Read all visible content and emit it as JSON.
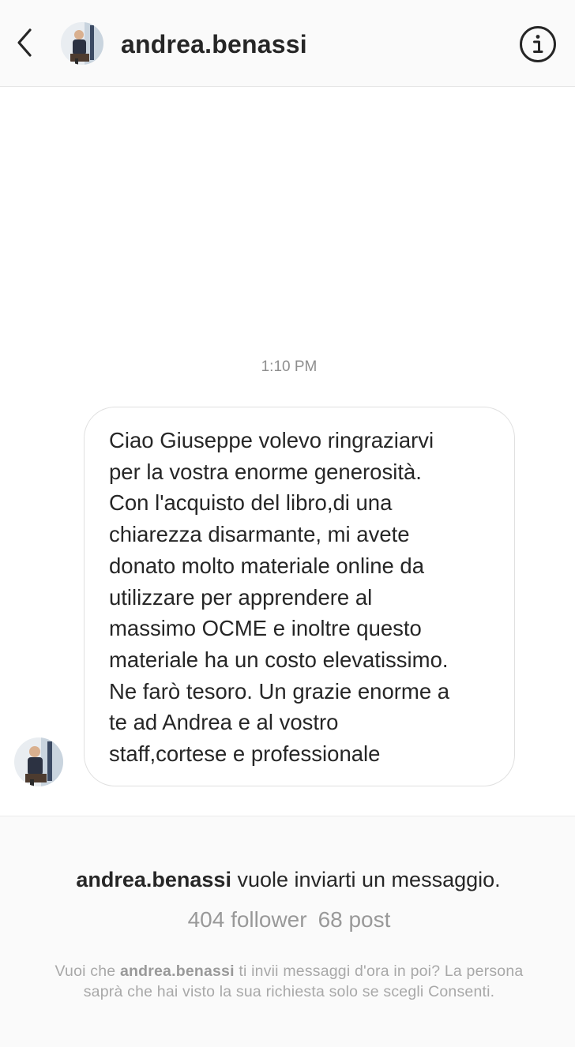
{
  "header": {
    "back_icon": "chevron-left-icon",
    "username": "andrea.benassi",
    "info_icon": "info-circle-icon"
  },
  "conversation": {
    "timestamp": "1:10 PM",
    "message": {
      "lines": [
        "Ciao Giuseppe volevo ringraziarvi",
        "per la vostra enorme generosità.",
        "Con l'acquisto del libro,di una",
        "chiarezza disarmante, mi avete",
        "donato molto materiale online da",
        "utilizzare per apprendere al",
        "massimo OCME e inoltre questo",
        "materiale ha un costo elevatissimo.",
        "Ne farò tesoro. Un grazie enorme a",
        "te ad Andrea e al vostro",
        "staff,cortese e professionale"
      ]
    }
  },
  "request": {
    "username": "andrea.benassi",
    "title_suffix": " vuole inviarti un messaggio.",
    "followers": "404 follower",
    "posts": "68 post",
    "note_prefix": "Vuoi che ",
    "note_username": "andrea.benassi",
    "note_suffix": " ti invii messaggi d'ora in poi? La persona saprà che hai visto la sua richiesta solo se scegli Consenti."
  },
  "colors": {
    "text_primary": "#262626",
    "text_secondary": "#8e8e8e",
    "bubble_border": "#e0e0e0",
    "panel_bg": "#fafafa"
  }
}
